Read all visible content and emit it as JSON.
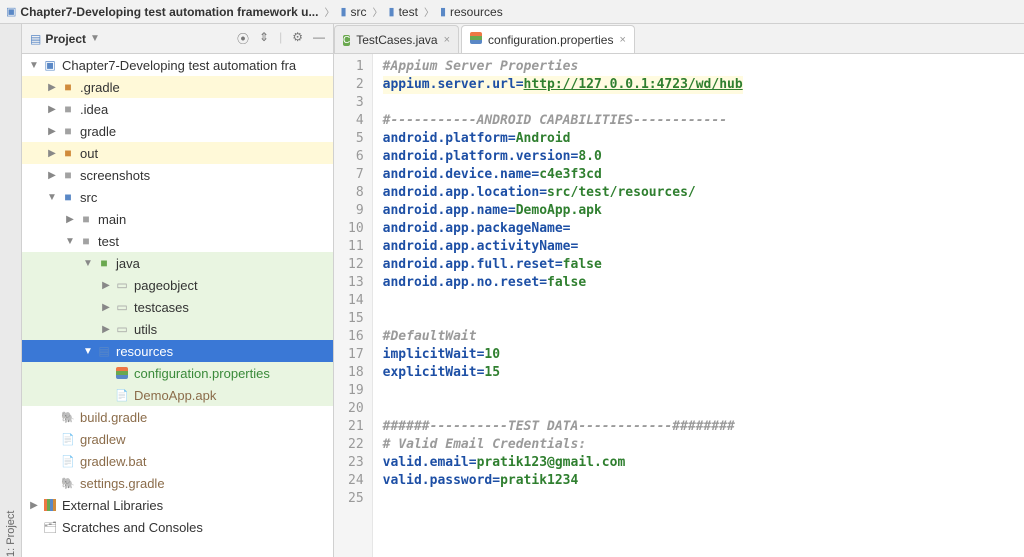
{
  "breadcrumb": {
    "items": [
      {
        "label": "Chapter7-Developing test automation framework u...",
        "root": true
      },
      {
        "label": "src"
      },
      {
        "label": "test"
      },
      {
        "label": "resources"
      }
    ]
  },
  "left_rail": {
    "label": "1: Project"
  },
  "project": {
    "title": "Project",
    "tree": [
      {
        "indent": 0,
        "arrow": "down",
        "icon": "module-root",
        "cls": "",
        "text": "Chapter7-Developing test automation fra"
      },
      {
        "indent": 1,
        "arrow": "right",
        "icon": "folder",
        "iconColor": "orange",
        "cls": "highlighted-yellow",
        "text": ".gradle"
      },
      {
        "indent": 1,
        "arrow": "right",
        "icon": "folder",
        "iconColor": "gray",
        "cls": "",
        "text": ".idea"
      },
      {
        "indent": 1,
        "arrow": "right",
        "icon": "folder",
        "iconColor": "gray",
        "cls": "",
        "text": "gradle"
      },
      {
        "indent": 1,
        "arrow": "right",
        "icon": "folder",
        "iconColor": "orange",
        "cls": "highlighted-yellow",
        "text": "out"
      },
      {
        "indent": 1,
        "arrow": "right",
        "icon": "folder",
        "iconColor": "gray",
        "cls": "",
        "text": "screenshots"
      },
      {
        "indent": 1,
        "arrow": "down",
        "icon": "folder",
        "iconColor": "blue",
        "cls": "",
        "text": "src"
      },
      {
        "indent": 2,
        "arrow": "right",
        "icon": "folder",
        "iconColor": "gray",
        "cls": "",
        "text": "main"
      },
      {
        "indent": 2,
        "arrow": "down",
        "icon": "folder",
        "iconColor": "gray",
        "cls": "",
        "text": "test"
      },
      {
        "indent": 3,
        "arrow": "down",
        "icon": "folder",
        "iconColor": "green",
        "cls": "highlighted-green",
        "text": "java"
      },
      {
        "indent": 4,
        "arrow": "right",
        "icon": "package",
        "iconColor": "gray",
        "cls": "highlighted-green",
        "text": "pageobject"
      },
      {
        "indent": 4,
        "arrow": "right",
        "icon": "package",
        "iconColor": "gray",
        "cls": "highlighted-green",
        "text": "testcases"
      },
      {
        "indent": 4,
        "arrow": "right",
        "icon": "package",
        "iconColor": "gray",
        "cls": "highlighted-green",
        "text": "utils"
      },
      {
        "indent": 3,
        "arrow": "down",
        "icon": "resources",
        "iconColor": "blue",
        "cls": "selected",
        "text": "resources"
      },
      {
        "indent": 4,
        "arrow": "",
        "icon": "props",
        "iconColor": "",
        "cls": "highlighted-green",
        "text": "configuration.properties",
        "textColor": "green"
      },
      {
        "indent": 4,
        "arrow": "",
        "icon": "apk",
        "iconColor": "",
        "cls": "highlighted-green",
        "text": "DemoApp.apk",
        "textColor": "brown"
      },
      {
        "indent": 1,
        "arrow": "",
        "icon": "gradle",
        "iconColor": "",
        "cls": "",
        "text": "build.gradle",
        "textColor": "brown"
      },
      {
        "indent": 1,
        "arrow": "",
        "icon": "file",
        "iconColor": "",
        "cls": "",
        "text": "gradlew",
        "textColor": "brown"
      },
      {
        "indent": 1,
        "arrow": "",
        "icon": "file",
        "iconColor": "",
        "cls": "",
        "text": "gradlew.bat",
        "textColor": "brown"
      },
      {
        "indent": 1,
        "arrow": "",
        "icon": "gradle",
        "iconColor": "",
        "cls": "",
        "text": "settings.gradle",
        "textColor": "brown"
      },
      {
        "indent": 0,
        "arrow": "right",
        "icon": "libraries",
        "iconColor": "",
        "cls": "",
        "text": "External Libraries"
      },
      {
        "indent": 0,
        "arrow": "",
        "icon": "scratches",
        "iconColor": "",
        "cls": "",
        "text": "Scratches and Consoles"
      }
    ]
  },
  "tabs": [
    {
      "label": "TestCases.java",
      "icon": "c",
      "active": false
    },
    {
      "label": "configuration.properties",
      "icon": "props",
      "active": true
    }
  ],
  "code": {
    "lines": [
      {
        "n": 1,
        "t": "comment",
        "text": "#Appium Server Properties"
      },
      {
        "n": 2,
        "t": "kv",
        "key": "appium.server.url",
        "val": "http://127.0.0.1:4723/wd/hub",
        "url": true,
        "highlight": true
      },
      {
        "n": 3,
        "t": "blank"
      },
      {
        "n": 4,
        "t": "comment",
        "text": "#-----------ANDROID CAPABILITIES------------"
      },
      {
        "n": 5,
        "t": "kv",
        "key": "android.platform",
        "val": "Android"
      },
      {
        "n": 6,
        "t": "kv",
        "key": "android.platform.version",
        "val": "8.0"
      },
      {
        "n": 7,
        "t": "kv",
        "key": "android.device.name",
        "val": "c4e3f3cd"
      },
      {
        "n": 8,
        "t": "kv",
        "key": "android.app.location",
        "val": "src/test/resources/"
      },
      {
        "n": 9,
        "t": "kv",
        "key": "android.app.name",
        "val": "DemoApp.apk"
      },
      {
        "n": 10,
        "t": "kv",
        "key": "android.app.packageName",
        "val": ""
      },
      {
        "n": 11,
        "t": "kv",
        "key": "android.app.activityName",
        "val": ""
      },
      {
        "n": 12,
        "t": "kv",
        "key": "android.app.full.reset",
        "val": "false"
      },
      {
        "n": 13,
        "t": "kv",
        "key": "android.app.no.reset",
        "val": "false"
      },
      {
        "n": 14,
        "t": "blank"
      },
      {
        "n": 15,
        "t": "blank"
      },
      {
        "n": 16,
        "t": "comment",
        "text": "#DefaultWait"
      },
      {
        "n": 17,
        "t": "kv",
        "key": "implicitWait",
        "val": "10"
      },
      {
        "n": 18,
        "t": "kv",
        "key": "explicitWait",
        "val": "15"
      },
      {
        "n": 19,
        "t": "blank"
      },
      {
        "n": 20,
        "t": "blank"
      },
      {
        "n": 21,
        "t": "comment",
        "text": "######----------TEST DATA------------########"
      },
      {
        "n": 22,
        "t": "comment",
        "text": "# Valid Email Credentials:"
      },
      {
        "n": 23,
        "t": "kv",
        "key": "valid.email",
        "val": "pratik123@gmail.com"
      },
      {
        "n": 24,
        "t": "kv",
        "key": "valid.password",
        "val": "pratik1234"
      },
      {
        "n": 25,
        "t": "blank"
      }
    ]
  }
}
